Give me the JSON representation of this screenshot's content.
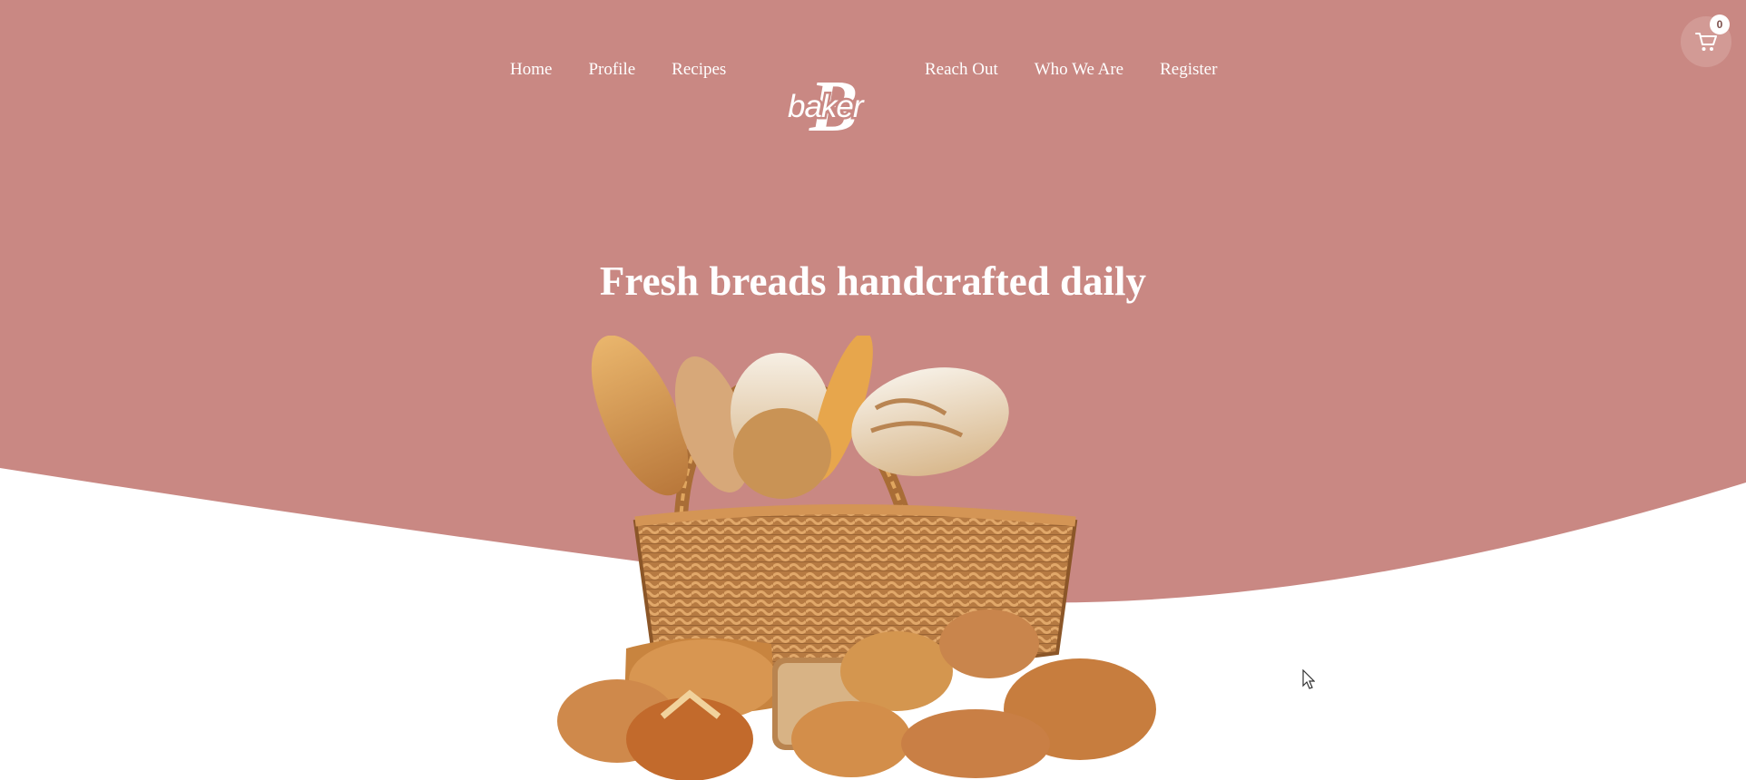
{
  "nav": {
    "left": [
      "Home",
      "Profile",
      "Recipes"
    ],
    "right": [
      "Reach Out",
      "Who We Are",
      "Register"
    ]
  },
  "logo": {
    "letter": "B",
    "word": "baker"
  },
  "cart": {
    "count": "0",
    "icon": "cart-icon"
  },
  "hero": {
    "title": "Fresh breads handcrafted daily",
    "image": "bread-basket-illustration"
  },
  "colors": {
    "hero_background": "#c98883",
    "page_background": "#ffffff",
    "nav_text": "#ffffff",
    "bread_crust": "#c58a4a",
    "basket": "#b57840"
  }
}
